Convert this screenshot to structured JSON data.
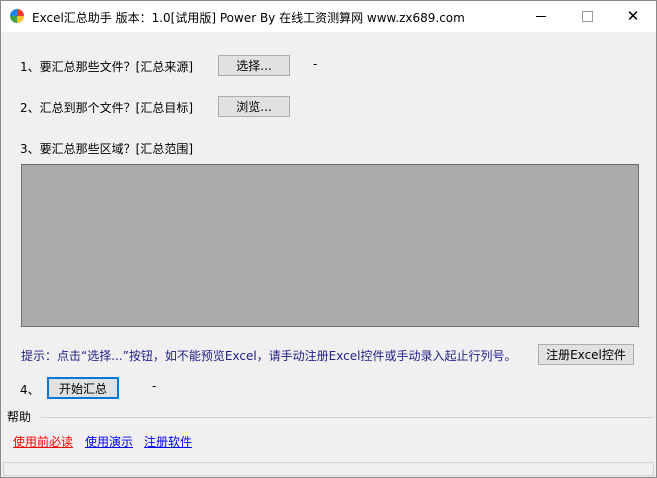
{
  "window": {
    "title": "Excel汇总助手 版本：1.0[试用版] Power By 在线工资测算网 www.zx689.com",
    "minimize_symbol": "",
    "close_symbol": "✕"
  },
  "step1": {
    "label": "1、要汇总那些文件？[汇总来源]",
    "button_label": "选择...",
    "status": "-"
  },
  "step2": {
    "label": "2、汇总到那个文件？[汇总目标]",
    "button_label": "浏览..."
  },
  "step3": {
    "label": "3、要汇总那些区域？[汇总范围]"
  },
  "tip": {
    "text": "提示：点击“选择...”按钮，如不能预览Excel，请手动注册Excel控件或手动录入起止行列号。",
    "register_button_label": "注册Excel控件"
  },
  "step4": {
    "label": "4、",
    "button_label": "开始汇总",
    "status": "-"
  },
  "help": {
    "group_title": "帮助",
    "links": [
      {
        "label": "使用前必读",
        "color": "#ff0000"
      },
      {
        "label": "使用演示",
        "color": "#0000ff"
      },
      {
        "label": "注册软件",
        "color": "#0000ff"
      }
    ]
  },
  "colors": {
    "preview_bg": "#ababab",
    "tip_text": "#1f1f8a",
    "focus": "#0078d7"
  }
}
